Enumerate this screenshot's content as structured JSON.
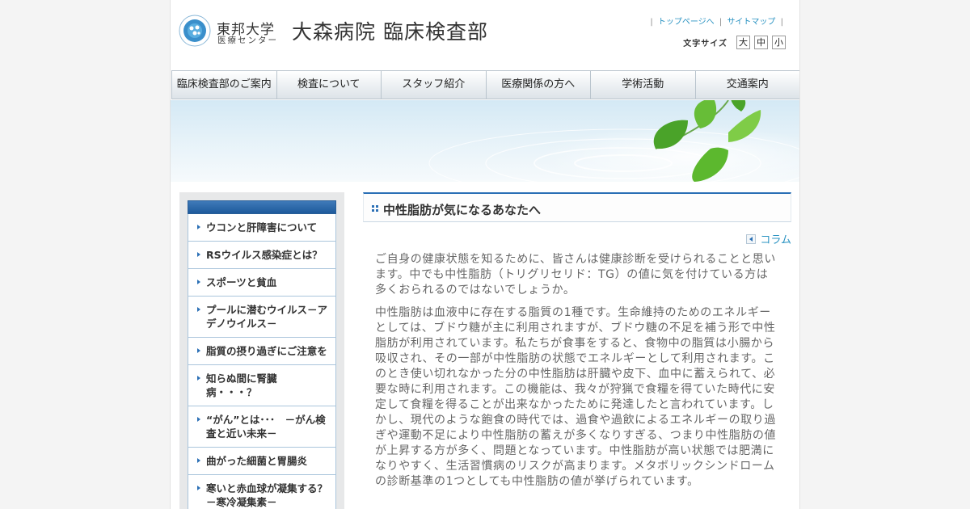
{
  "header": {
    "university_name": "東邦大学",
    "university_sub": "医療センター",
    "site_title": "大森病院 臨床検査部",
    "util_links": [
      {
        "label": "トップページへ"
      },
      {
        "label": "サイトマップ"
      }
    ],
    "fontsize_label": "文字サイズ",
    "fontsize_options": [
      "大",
      "中",
      "小"
    ]
  },
  "nav": {
    "items": [
      "臨床検査部のご案内",
      "検査について",
      "スタッフ紹介",
      "医療関係の方へ",
      "学術活動",
      "交通案内"
    ]
  },
  "sidebar": {
    "items": [
      "ウコンと肝障害について",
      "RSウイルス感染症とは？",
      "スポーツと貧血",
      "プールに潜むウイルス－アデノウイルス－",
      "脂質の摂り過ぎにご注意を",
      "知らぬ間に腎臓病・・・？",
      "“がん”とは･･･　－がん検査と近い未来－",
      "曲がった細菌と胃腸炎",
      "寒いと赤血球が凝集する？　－寒冷凝集素－"
    ]
  },
  "main": {
    "title": "中性脂肪が気になるあなたへ",
    "category_link": "コラム",
    "paragraphs": [
      "ご自身の健康状態を知るために、皆さんは健康診断を受けられることと思います。中でも中性脂肪（トリグリセリド：TG）の値に気を付けている方は多くおられるのではないでしょうか。",
      "中性脂肪は血液中に存在する脂質の1種です。生命維持のためのエネルギーとしては、ブドウ糖が主に利用されますが、ブドウ糖の不足を補う形で中性脂肪が利用されています。私たちが食事をすると、食物中の脂質は小腸から吸収され、その一部が中性脂肪の状態でエネルギーとして利用されます。このとき使い切れなかった分の中性脂肪は肝臓や皮下、血中に蓄えられて、必要な時に利用されます。この機能は、我々が狩猟で食糧を得ていた時代に安定して食糧を得ることが出来なかったために発達したと言われています。しかし、現代のような飽食の時代では、過食や過飲によるエネルギーの取り過ぎや運動不足により中性脂肪の蓄えが多くなりすぎる、つまり中性脂肪の値が上昇する方が多く、問題となっています。中性脂肪が高い状態では肥満になりやすく、生活習慣病のリスクが高まります。メタボリックシンドロームの診断基準の1つとしても中性脂肪の値が挙げられています。"
    ]
  },
  "colors": {
    "accent_blue": "#2a6fb5",
    "link_blue": "#2a93c2",
    "leaf_green": "#5cb82e"
  }
}
